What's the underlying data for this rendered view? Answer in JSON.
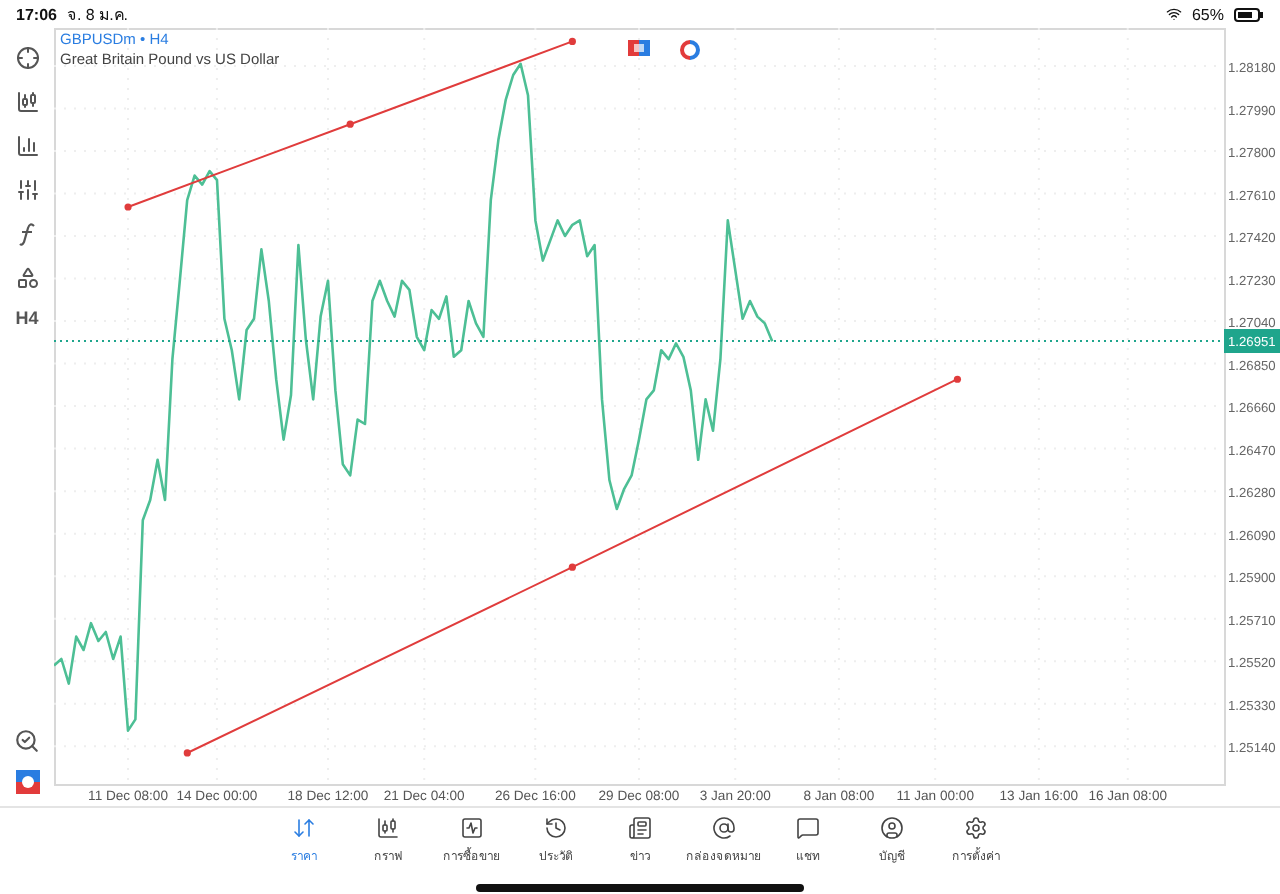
{
  "status_bar": {
    "time": "17:06",
    "date": "จ. 8 ม.ค.",
    "battery": "65%"
  },
  "toolbar": {
    "timeframe": "H4"
  },
  "chart": {
    "title": "GBPUSDm • H4",
    "description": "Great Britain Pound vs US Dollar",
    "chart_data": {
      "type": "line",
      "grid": true,
      "categories": [
        null,
        null,
        null,
        null,
        null,
        null,
        null,
        null,
        null,
        null,
        "11 Dec 08:00",
        null,
        null,
        null,
        null,
        null,
        null,
        null,
        null,
        null,
        null,
        null,
        "14 Dec 00:00",
        null,
        null,
        null,
        null,
        null,
        null,
        null,
        null,
        null,
        null,
        null,
        null,
        null,
        null,
        "18 Dec 12:00",
        null,
        null,
        null,
        null,
        null,
        null,
        null,
        null,
        null,
        null,
        null,
        null,
        "21 Dec 04:00",
        null,
        null,
        null,
        null,
        null,
        null,
        null,
        null,
        null,
        null,
        null,
        null,
        null,
        null,
        "26 Dec 16:00",
        null,
        null,
        null,
        null,
        null,
        null,
        null,
        null,
        null,
        null,
        null,
        null,
        null,
        "29 Dec 08:00",
        null,
        null,
        null,
        null,
        null,
        null,
        null,
        null,
        null,
        null,
        null,
        null,
        "3 Jan 20:00",
        null,
        null,
        null,
        null,
        null,
        null,
        null,
        null,
        null,
        null,
        null,
        null,
        null,
        "8 Jan 08:00",
        null,
        null,
        null,
        null,
        null,
        null,
        null,
        null,
        null,
        null,
        null,
        null,
        "11 Jan 00:00",
        null,
        null,
        null,
        null,
        null,
        null,
        null,
        null,
        null,
        null,
        null,
        null,
        null,
        "13 Jan 16:00",
        null,
        null,
        null,
        null,
        null,
        null,
        null,
        null,
        null,
        null,
        null,
        "16 Jan 08:00",
        null,
        null,
        null,
        null,
        null,
        null,
        null,
        null,
        null,
        null,
        null,
        null,
        null
      ],
      "series": [
        {
          "color": "#4dbf95",
          "values": [
            1.255,
            1.2553,
            1.2542,
            1.2563,
            1.2557,
            1.2569,
            1.2561,
            1.2565,
            1.2553,
            1.2563,
            1.2521,
            1.2526,
            1.2615,
            1.2624,
            1.2642,
            1.2624,
            1.2687,
            1.2722,
            1.2758,
            1.2769,
            1.2765,
            1.2771,
            1.2767,
            1.2705,
            1.2691,
            1.2669,
            1.27,
            1.2705,
            1.2736,
            1.2713,
            1.2678,
            1.2651,
            1.2671,
            1.2738,
            1.2696,
            1.2669,
            1.2706,
            1.2722,
            1.2673,
            1.264,
            1.2635,
            1.266,
            1.2658,
            1.2713,
            1.2722,
            1.2713,
            1.2706,
            1.2722,
            1.2718,
            1.2697,
            1.2691,
            1.2709,
            1.2705,
            1.2715,
            1.2688,
            1.2691,
            1.2713,
            1.2703,
            1.2697,
            1.2758,
            1.2785,
            1.2803,
            1.2814,
            1.2819,
            1.2805,
            1.2749,
            1.2731,
            1.274,
            1.2749,
            1.2742,
            1.2747,
            1.2749,
            1.2733,
            1.2738,
            1.2669,
            1.2633,
            1.262,
            1.2629,
            1.2635,
            1.2651,
            1.2669,
            1.2673,
            1.2691,
            1.2687,
            1.2694,
            1.2688,
            1.2673,
            1.2642,
            1.2669,
            1.2655,
            1.2687,
            1.2749,
            1.2727,
            1.2705,
            1.2713,
            1.2706,
            1.2703,
            1.2695,
            null,
            null,
            null,
            null,
            null,
            null,
            null,
            null,
            null,
            null,
            null,
            null,
            null,
            null,
            null,
            null,
            null,
            null,
            null,
            null,
            null,
            null,
            null,
            null,
            null,
            null,
            null,
            null,
            null,
            null,
            null,
            null,
            null,
            null,
            null,
            null,
            null,
            null,
            null,
            null,
            null,
            null,
            null,
            null,
            null,
            null,
            null,
            null,
            null,
            null,
            null,
            null,
            null,
            null,
            null,
            null,
            null,
            null,
            null,
            null,
            null
          ]
        },
        {
          "color": "#e03c3c",
          "marker": "circle",
          "values": [
            null,
            null,
            null,
            null,
            null,
            null,
            null,
            null,
            null,
            null,
            1.2755,
            null,
            null,
            null,
            null,
            null,
            null,
            null,
            null,
            null,
            null,
            null,
            null,
            null,
            null,
            null,
            null,
            null,
            null,
            null,
            null,
            null,
            null,
            null,
            null,
            null,
            null,
            null,
            null,
            null,
            1.2792,
            null,
            null,
            null,
            null,
            null,
            null,
            null,
            null,
            null,
            null,
            null,
            null,
            null,
            null,
            null,
            null,
            null,
            null,
            null,
            null,
            null,
            null,
            null,
            null,
            null,
            null,
            null,
            null,
            null,
            1.2829,
            null,
            null,
            null,
            null,
            null,
            null,
            null,
            null,
            null,
            null,
            null,
            null,
            null,
            null,
            null,
            null,
            null,
            null,
            null,
            null,
            null,
            null,
            null,
            null,
            null,
            null,
            null,
            null,
            null,
            null,
            null,
            null,
            null,
            null,
            null,
            null,
            null,
            null,
            null,
            null,
            null,
            null,
            null,
            null,
            null,
            null,
            null,
            null,
            null,
            null,
            null,
            null,
            null,
            null,
            null,
            null,
            null,
            null,
            null,
            null,
            null,
            null,
            null,
            null,
            null,
            null,
            null,
            null,
            null,
            null,
            null,
            null,
            null,
            null,
            null,
            null,
            null,
            null,
            null,
            null,
            null,
            null,
            null,
            null,
            null,
            null,
            null,
            null
          ]
        },
        {
          "color": "#e03c3c",
          "marker": "circle",
          "values": [
            null,
            null,
            null,
            null,
            null,
            null,
            null,
            null,
            null,
            null,
            null,
            null,
            null,
            null,
            null,
            null,
            null,
            null,
            1.2511,
            null,
            null,
            null,
            null,
            null,
            null,
            null,
            null,
            null,
            null,
            null,
            null,
            null,
            null,
            null,
            null,
            null,
            null,
            null,
            null,
            null,
            null,
            null,
            null,
            null,
            null,
            null,
            null,
            null,
            null,
            null,
            null,
            null,
            null,
            null,
            null,
            null,
            null,
            null,
            null,
            null,
            null,
            null,
            null,
            null,
            null,
            null,
            null,
            null,
            null,
            null,
            1.2594,
            null,
            null,
            null,
            null,
            null,
            null,
            null,
            null,
            null,
            null,
            null,
            null,
            null,
            null,
            null,
            null,
            null,
            null,
            null,
            null,
            null,
            null,
            null,
            null,
            null,
            null,
            null,
            null,
            null,
            null,
            null,
            null,
            null,
            null,
            null,
            null,
            null,
            null,
            null,
            null,
            null,
            null,
            null,
            null,
            null,
            null,
            null,
            null,
            null,
            null,
            null,
            1.2678,
            null,
            null,
            null,
            null,
            null,
            null,
            null,
            null,
            null,
            null,
            null,
            null,
            null,
            null,
            null,
            null,
            null,
            null,
            null,
            null,
            null,
            null,
            null,
            null,
            null,
            null,
            null,
            null,
            null,
            null,
            null,
            null,
            null,
            null,
            null,
            null
          ]
        }
      ],
      "ylim": [
        1.24971,
        1.2835
      ],
      "yticks": [
        {
          "value": 1.2818,
          "label": "1.28180"
        },
        {
          "value": 1.2799,
          "label": "1.27990"
        },
        {
          "value": 1.278,
          "label": "1.27800"
        },
        {
          "value": 1.2761,
          "label": "1.27610"
        },
        {
          "value": 1.2742,
          "label": "1.27420"
        },
        {
          "value": 1.2723,
          "label": "1.27230"
        },
        {
          "value": 1.2704,
          "label": "1.27040"
        },
        {
          "value": 1.2685,
          "label": "1.26850"
        },
        {
          "value": 1.2666,
          "label": "1.26660"
        },
        {
          "value": 1.2647,
          "label": "1.26470"
        },
        {
          "value": 1.2628,
          "label": "1.26280"
        },
        {
          "value": 1.2609,
          "label": "1.26090"
        },
        {
          "value": 1.259,
          "label": "1.25900"
        },
        {
          "value": 1.2571,
          "label": "1.25710"
        },
        {
          "value": 1.2552,
          "label": "1.25520"
        },
        {
          "value": 1.2533,
          "label": "1.25330"
        },
        {
          "value": 1.2514,
          "label": "1.25140"
        }
      ],
      "ref_lines": [
        {
          "axis": "y",
          "value": 1.26951,
          "label": "1.26951",
          "color": "#1fa58c"
        }
      ]
    }
  },
  "tabs": [
    {
      "label": "ราคา",
      "selected": true
    },
    {
      "label": "กราฟ",
      "selected": false
    },
    {
      "label": "การซื้อขาย",
      "selected": false
    },
    {
      "label": "ประวัติ",
      "selected": false
    },
    {
      "label": "ข่าว",
      "selected": false
    },
    {
      "label": "กล่องจดหมาย",
      "selected": false
    },
    {
      "label": "แชท",
      "selected": false
    },
    {
      "label": "บัญชี",
      "selected": false
    },
    {
      "label": "การตั้งค่า",
      "selected": false
    }
  ]
}
